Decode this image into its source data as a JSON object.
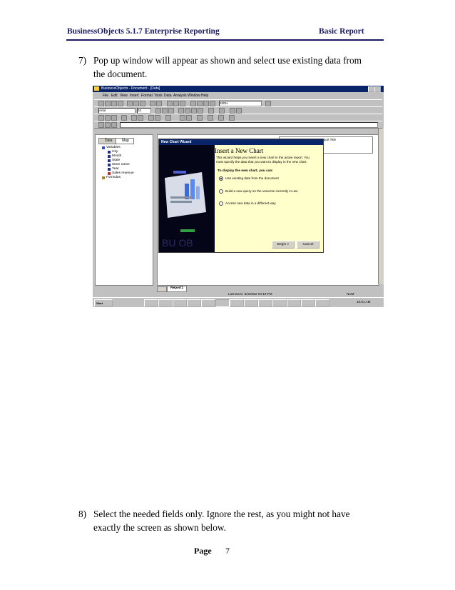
{
  "header": {
    "left": "BusinessObjects 5.1.7 Enterprise Reporting",
    "right": "Basic Report"
  },
  "steps": [
    {
      "number": "7)",
      "lines": [
        "Pop up window will appear as shown and select use existing data from",
        "the document."
      ]
    },
    {
      "number": "8)",
      "lines": [
        "Select the needed fields only. Ignore the rest, as you might not have",
        "exactly the screen as shown below."
      ]
    }
  ],
  "footer": {
    "label": "Page",
    "number": "7"
  },
  "screenshot": {
    "title": "BusinessObjects - Document - [Data]",
    "menu": [
      "File",
      "Edit",
      "View",
      "Insert",
      "Format",
      "Tools",
      "Data",
      "Analysis",
      "Window",
      "Help"
    ],
    "zoom": "100%",
    "font": "Arial",
    "font_size": "10",
    "tabs": [
      "Data",
      "Map"
    ],
    "tree": [
      {
        "label": "Variables",
        "level": 0
      },
      {
        "label": "City",
        "level": 1
      },
      {
        "label": "Month",
        "level": 1
      },
      {
        "label": "State",
        "level": 1
      },
      {
        "label": "Store name",
        "level": 1
      },
      {
        "label": "Year",
        "level": 1
      },
      {
        "label": "Sales revenue",
        "level": 1
      },
      {
        "label": "Formulas",
        "level": 0
      }
    ],
    "report_title_partial": "Report Title",
    "wizard": {
      "window_title": "New Chart Wizard",
      "heading": "Insert a New Chart",
      "description": "This wizard helps you insert a new chart in the active report. You must specify the data that you want to display in the new chart.",
      "subheading": "To display the new chart, you can:",
      "options": [
        {
          "label": "Use existing data from the document",
          "selected": true
        },
        {
          "label": "Build a new query on the universe currently in use",
          "selected": false
        },
        {
          "label": "Access new data in a different way",
          "selected": false
        }
      ],
      "buttons": [
        "Begin >",
        "Cancel"
      ]
    },
    "sheet_tab": "Report1",
    "status": {
      "last_exec": "Last Exec: 8/4/2002  04:19 PM",
      "num": "NUM"
    },
    "taskbar": {
      "start": "Start",
      "clock": "10:01 AM"
    }
  }
}
